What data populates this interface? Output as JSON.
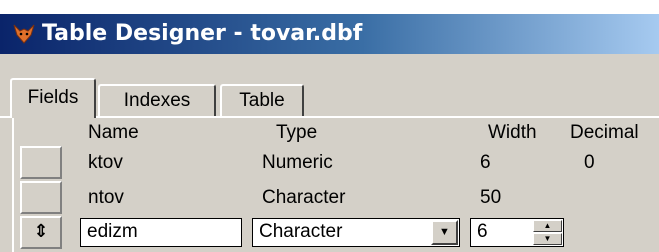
{
  "window": {
    "title": "Table Designer - tovar.dbf",
    "icon": "foxpro-icon"
  },
  "tabs": [
    {
      "label": "Fields",
      "active": true
    },
    {
      "label": "Indexes",
      "active": false
    },
    {
      "label": "Table",
      "active": false
    }
  ],
  "columns": {
    "name": "Name",
    "type": "Type",
    "width": "Width",
    "decimal": "Decimal"
  },
  "rows": [
    {
      "name": "ktov",
      "type": "Numeric",
      "width": "6",
      "decimal": "0"
    },
    {
      "name": "ntov",
      "type": "Character",
      "width": "50",
      "decimal": ""
    },
    {
      "name": "edizm",
      "type": "Character",
      "width": "6",
      "decimal": ""
    }
  ],
  "colors": {
    "title_gradient_start": "#0a246a",
    "title_gradient_end": "#a6caf0",
    "face": "#d4d0c8"
  }
}
